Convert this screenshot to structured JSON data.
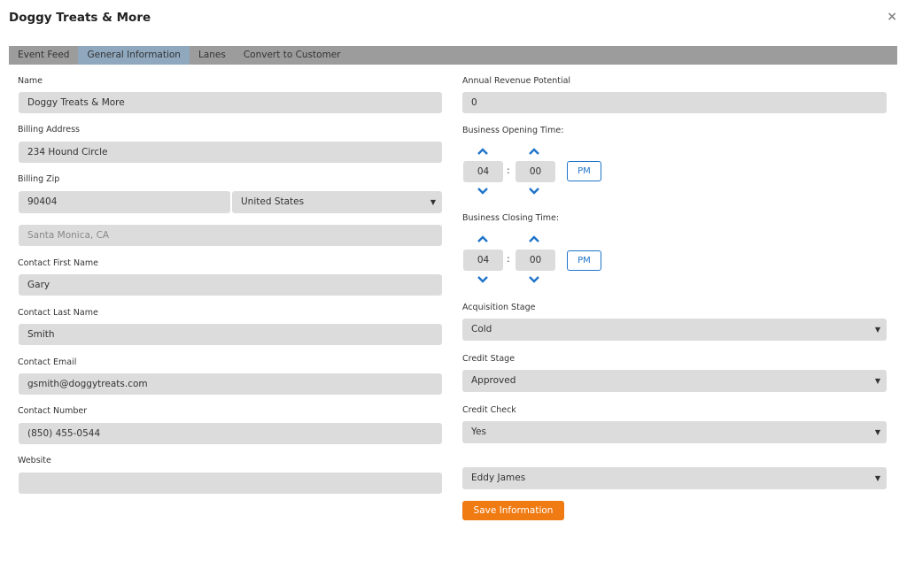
{
  "window": {
    "title": "Doggy Treats & More",
    "close_label": "×"
  },
  "tabs": [
    {
      "label": "Event Feed"
    },
    {
      "label": "General Information"
    },
    {
      "label": "Lanes"
    },
    {
      "label": "Convert to Customer"
    }
  ],
  "left": {
    "name_label": "Name",
    "name_value": "Doggy Treats & More",
    "billing_address_label": "Billing Address",
    "billing_address_value": "234 Hound Circle",
    "billing_zip_label": "Billing Zip",
    "billing_zip_value": "90404",
    "country_value": "United States",
    "city_value": "Santa Monica, CA",
    "first_name_label": "Contact First Name",
    "first_name_value": "Gary",
    "last_name_label": "Contact Last Name",
    "last_name_value": "Smith",
    "email_label": "Contact Email",
    "email_value": "gsmith@doggytreats.com",
    "number_label": "Contact Number",
    "number_value": "(850) 455-0544",
    "website_label": "Website",
    "website_value": ""
  },
  "right": {
    "revenue_label": "Annual Revenue Potential",
    "revenue_value": "0",
    "opening_label": "Business Opening Time:",
    "opening_hour": "04",
    "opening_minute": "00",
    "opening_ampm": "PM",
    "closing_label": "Business Closing Time:",
    "closing_hour": "04",
    "closing_minute": "00",
    "closing_ampm": "PM",
    "time_separator": ":",
    "acquisition_label": "Acquisition Stage",
    "acquisition_value": "Cold",
    "credit_stage_label": "Credit Stage",
    "credit_stage_value": "Approved",
    "credit_check_label": "Credit Check",
    "credit_check_value": "Yes",
    "owner_value": "Eddy James",
    "save_label": "Save Information"
  },
  "icons": {
    "up": "chevron-up-icon",
    "down": "chevron-down-icon",
    "caret": "caret-down-icon",
    "close": "close-icon"
  },
  "colors": {
    "accent": "#1f74c9",
    "save": "#f07b13",
    "tab_active": "#8fa8be",
    "tabbar": "#9c9c9c",
    "field": "#dcdcdc"
  }
}
